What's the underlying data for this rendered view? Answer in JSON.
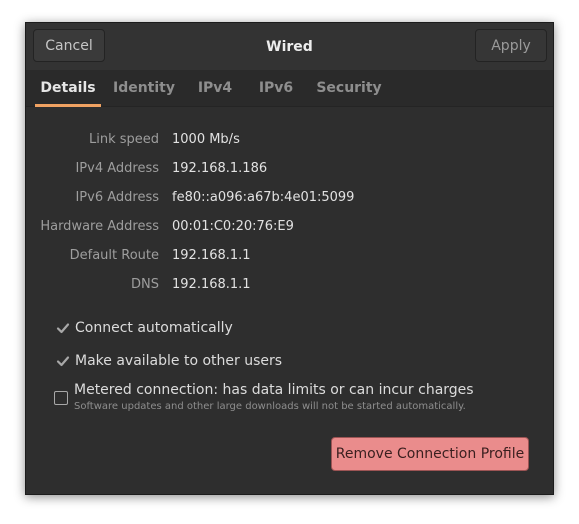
{
  "window": {
    "title": "Wired",
    "cancel_label": "Cancel",
    "apply_label": "Apply"
  },
  "tabs": [
    {
      "label": "Details",
      "active": true
    },
    {
      "label": "Identity",
      "active": false
    },
    {
      "label": "IPv4",
      "active": false
    },
    {
      "label": "IPv6",
      "active": false
    },
    {
      "label": "Security",
      "active": false
    }
  ],
  "details": [
    {
      "label": "Link speed",
      "value": "1000 Mb/s"
    },
    {
      "label": "IPv4 Address",
      "value": "192.168.1.186"
    },
    {
      "label": "IPv6 Address",
      "value": "fe80::a096:a67b:4e01:5099"
    },
    {
      "label": "Hardware Address",
      "value": "00:01:C0:20:76:E9"
    },
    {
      "label": "Default Route",
      "value": "192.168.1.1"
    },
    {
      "label": "DNS",
      "value": "192.168.1.1"
    }
  ],
  "options": {
    "connect_automatically": {
      "label": "Connect automatically",
      "checked": true
    },
    "available_to_others": {
      "label": "Make available to other users",
      "checked": true
    },
    "metered": {
      "label": "Metered connection: has data limits or can incur charges",
      "sublabel": "Software updates and other large downloads will not be started automatically.",
      "checked": false
    }
  },
  "remove_button_label": "Remove Connection Profile",
  "colors": {
    "accent": "#f0a262",
    "destructive": "#ea8c8c",
    "background": "#2e2e2e"
  },
  "icons": {
    "check": "checkmark-icon"
  }
}
